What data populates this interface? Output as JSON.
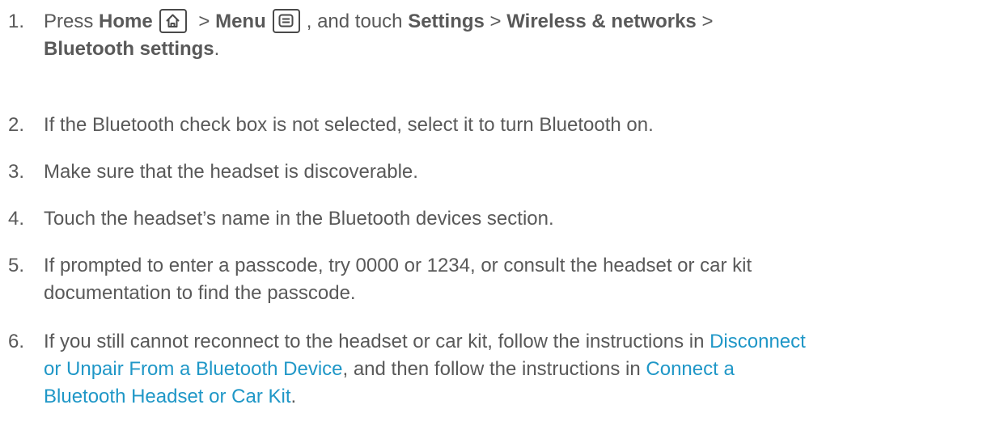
{
  "steps": [
    {
      "num": "1.",
      "press": "Press",
      "home": "Home",
      "sep1": ">",
      "menu": "Menu",
      "and_touch": ", and touch",
      "settings": "Settings",
      "sep2": ">",
      "wireless": "Wireless & networks",
      "sep3": ">",
      "bt_settings": "Bluetooth settings",
      "end": "."
    },
    {
      "num": "2.",
      "text": "If the Bluetooth check box is not selected, select it to turn Bluetooth on."
    },
    {
      "num": "3.",
      "text": "Make sure that the headset is discoverable."
    },
    {
      "num": "4.",
      "text": "Touch the headset’s name in the Bluetooth devices section."
    },
    {
      "num": "5.",
      "line1": "If prompted to enter a passcode, try 0000 or 1234, or consult the headset or car kit",
      "line2": "documentation to find the passcode."
    },
    {
      "num": "6.",
      "pre": "If you still cannot reconnect to the headset or car kit, follow the instructions in",
      "link1_a": "Disconnect",
      "link1_b": "or Unpair From a Bluetooth Device",
      "mid": ", and then follow the instructions in",
      "link2_a": "Connect a",
      "link2_b": "Bluetooth Headset or Car Kit",
      "end": "."
    }
  ],
  "icons": {
    "home": "home-key-icon",
    "menu": "menu-key-icon"
  },
  "colors": {
    "text": "#595959",
    "link": "#1f97c7"
  }
}
